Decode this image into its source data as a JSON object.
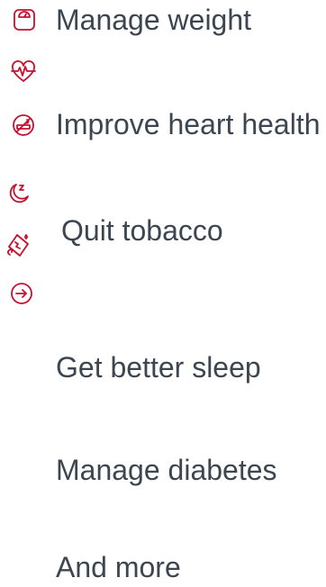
{
  "accent_color": "#c8102e",
  "text_color": "#3c4650",
  "goals": [
    {
      "label": "Manage weight",
      "icon": "scale-icon"
    },
    {
      "label": "Improve heart health",
      "icon": "heartbeat-icon"
    },
    {
      "label": "Quit tobacco",
      "icon": "no-smoking-icon"
    },
    {
      "label": "Get better sleep",
      "icon": "sleep-icon"
    },
    {
      "label": "Manage diabetes",
      "icon": "glucose-meter-icon"
    },
    {
      "label": "And more",
      "icon": "arrow-circle-right-icon"
    }
  ]
}
